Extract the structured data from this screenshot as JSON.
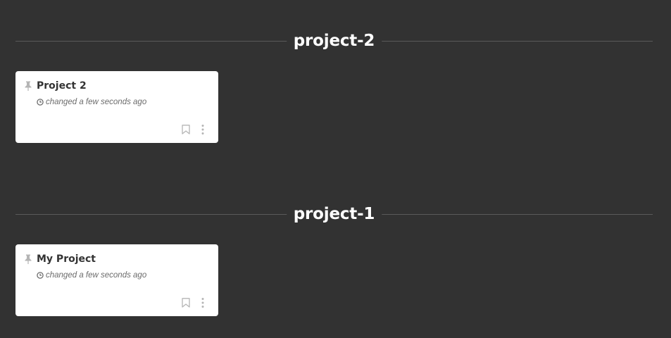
{
  "sections": [
    {
      "title": "project-2",
      "card": {
        "title": "Project 2",
        "meta": "changed a few seconds ago"
      }
    },
    {
      "title": "project-1",
      "card": {
        "title": "My Project",
        "meta": "changed a few seconds ago"
      }
    }
  ],
  "colors": {
    "background": "#323232",
    "card": "#ffffff",
    "icon": "#b5b5b5"
  },
  "icons": [
    "pin-icon",
    "clock-icon",
    "bookmark-icon",
    "more-vertical-icon"
  ]
}
